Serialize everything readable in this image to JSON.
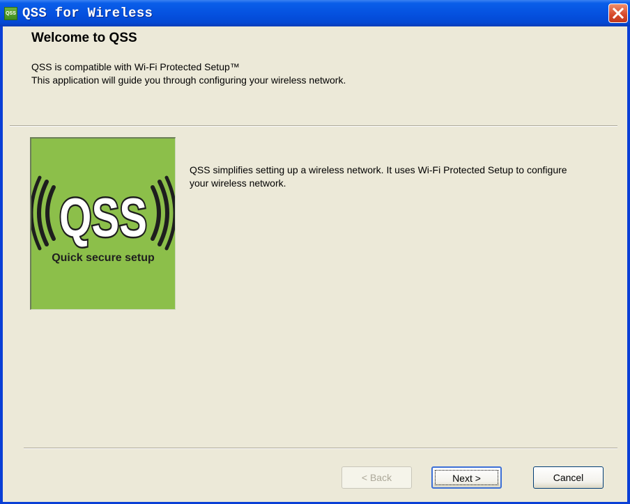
{
  "window": {
    "title": "QSS for Wireless",
    "icon_label": "QSS"
  },
  "header": {
    "title": "Welcome to QSS",
    "line1": "QSS is compatible with Wi-Fi Protected Setup™",
    "line2": "This application will guide you through configuring your wireless network."
  },
  "logo": {
    "text": "QSS",
    "caption": "Quick secure setup"
  },
  "description": "QSS simplifies setting up a wireless network. It uses Wi-Fi Protected Setup to configure your wireless network.",
  "buttons": {
    "back": "< Back",
    "next": "Next >",
    "cancel": "Cancel"
  },
  "colors": {
    "titlebar": "#0552e0",
    "client_bg": "#ece9d8",
    "logo_green": "#8cbf4a",
    "close_red": "#d6482a"
  },
  "icons": [
    "qss-app-icon",
    "close-icon"
  ]
}
